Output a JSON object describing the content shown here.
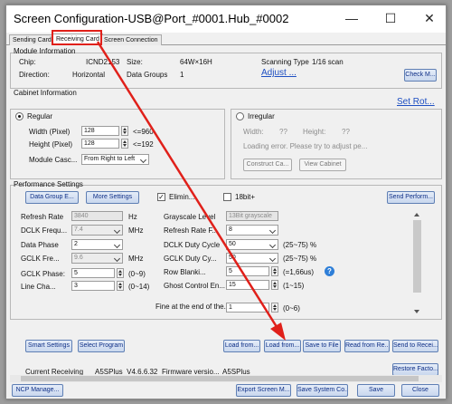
{
  "window": {
    "title": "Screen Configuration-USB@Port_#0001.Hub_#0002",
    "minimize": "—",
    "maximize": "☐",
    "close": "✕"
  },
  "tabs": [
    "Sending Card",
    "Receiving Card",
    "Screen Connection"
  ],
  "module_info": {
    "group_title": "Module Information",
    "chip_label": "Chip:",
    "chip_value": "ICND2153",
    "size_label": "Size:",
    "size_value": "64W×16H",
    "scan_label": "Scanning Type",
    "scan_value": "1/16 scan",
    "direction_label": "Direction:",
    "direction_value": "Horizontal",
    "data_groups_label": "Data Groups",
    "data_groups_value": "1",
    "adjust_link": "Adjust ...",
    "check_button": "Check M..."
  },
  "cabinet": {
    "group_title": "Cabinet Information",
    "set_rotation_link": "Set Rot...",
    "regular_label": "Regular",
    "width_label": "Width (Pixel)",
    "width_value": "128",
    "width_limit": "<=960",
    "height_label": "Height (Pixel)",
    "height_value": "128",
    "height_limit": "<=192",
    "cascade_label": "Module Casc...",
    "cascade_value": "From Right to Left",
    "irregular_label": "Irregular",
    "irr_width_label": "Width:",
    "irr_width_value": "??",
    "irr_height_label": "Height:",
    "irr_height_value": "??",
    "loading_error": "Loading error. Please try to adjust pe...",
    "construct_button": "Construct Ca...",
    "view_button": "View Cabinet"
  },
  "performance": {
    "group_title": "Performance Settings",
    "data_group_button": "Data Group E...",
    "more_settings_button": "More Settings",
    "eliminate_label": "Elimin...",
    "eliminate_checked": "✓",
    "bit18_label": "18bit+",
    "send_performance_button": "Send Perform...",
    "refresh_rate_label": "Refresh Rate",
    "refresh_rate_value": "3840",
    "refresh_rate_unit": "Hz",
    "dclk_freq_label": "DCLK Frequ...",
    "dclk_freq_value": "7.4",
    "dclk_freq_unit": "MHz",
    "data_phase_label": "Data Phase",
    "data_phase_value": "2",
    "gclk_freq_label": "GCLK Fre...",
    "gclk_freq_value": "9.6",
    "gclk_freq_unit": "MHz",
    "gclk_phase_label": "GCLK Phase:",
    "gclk_phase_value": "5",
    "gclk_phase_range": "(0~9)",
    "line_change_label": "Line Cha...",
    "line_change_value": "3",
    "line_change_range": "(0~14)",
    "grayscale_label": "Grayscale Level",
    "grayscale_value": "13Bit grayscale",
    "refresh_rate_f_label": "Refresh Rate F...",
    "refresh_rate_f_value": "8",
    "dclk_duty_label": "DCLK Duty Cycle",
    "dclk_duty_value": "50",
    "dclk_duty_range": "(25~75) %",
    "gclk_duty_label": "GCLK Duty Cy...",
    "gclk_duty_value": "50",
    "gclk_duty_range": "(25~75) %",
    "row_blank_label": "Row Blanki...",
    "row_blank_value": "5",
    "row_blank_range": "(=1,66us)",
    "ghost_label": "Ghost Control En...",
    "ghost_value": "15",
    "ghost_range": "(1~15)",
    "fine_label": "Fine at the end of the...",
    "fine_value": "1",
    "fine_range": "(0~6)"
  },
  "buttons": {
    "smart_settings": "Smart Settings",
    "select_program": "Select Program",
    "load_from_1": "Load from...",
    "load_from_2": "Load from...",
    "save_to_file": "Save to File",
    "read_from": "Read from Re...",
    "send_to": "Send to Recei...",
    "restore": "Restore Facto..."
  },
  "footer": {
    "current_receiving_label": "Current Receiving",
    "current_receiving_value": "A5SPlus_V4.6.6.32",
    "firmware_label": "Firmware versio...",
    "firmware_value": "A5SPlus",
    "ncp_manage": "NCP Manage...",
    "export_screen": "Export Screen M...",
    "save_system": "Save System Co...",
    "save": "Save",
    "close": "Close"
  },
  "accent_colors": {
    "annotation_red": "#e0201a",
    "button_text": "#0d2e86",
    "link_blue": "#1e4fc2"
  }
}
